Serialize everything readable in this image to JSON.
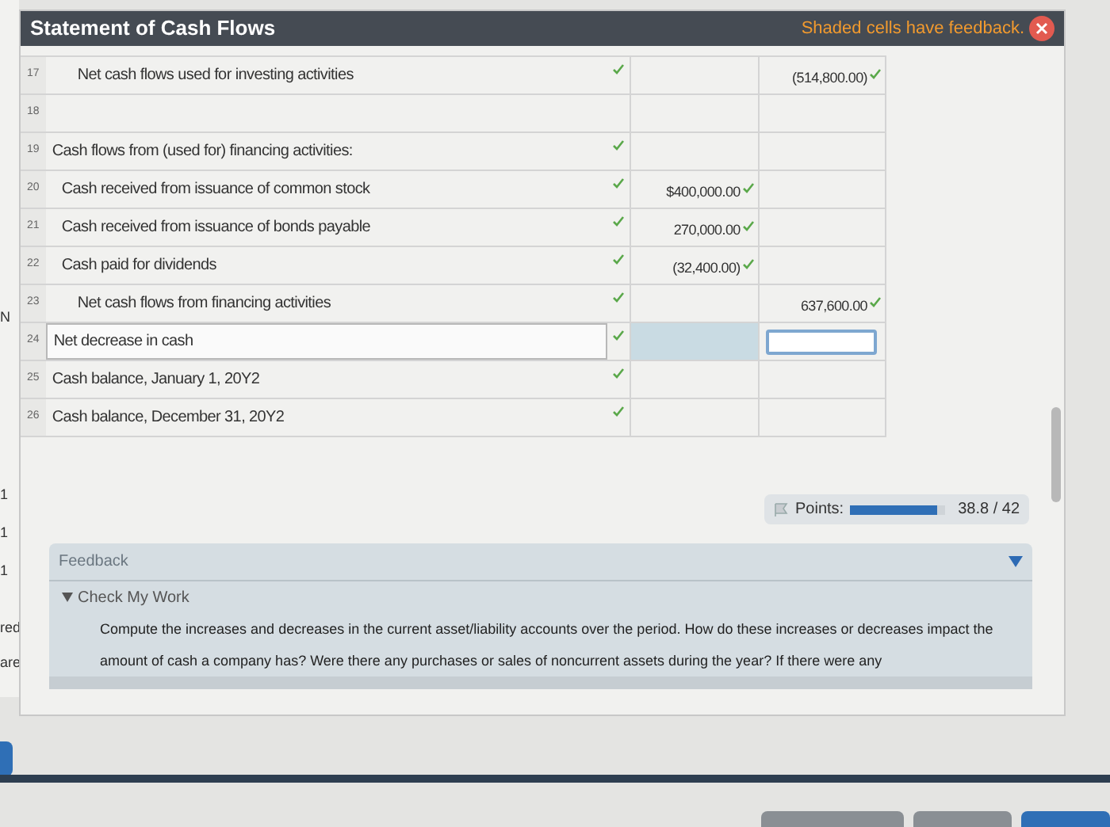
{
  "header": {
    "title": "Statement of Cash Flows",
    "feedback_note": "Shaded cells have feedback."
  },
  "side_fragments": [
    "N",
    "1",
    "1",
    "1",
    "red",
    "are"
  ],
  "rows": [
    {
      "number": "17",
      "label": "Net cash flows used for investing activities",
      "kind": "total",
      "checked": true,
      "amount_1": "",
      "amount_2": "(514,800.00)",
      "selected": false
    },
    {
      "number": "18",
      "label": "",
      "kind": "line",
      "checked": false,
      "amount_1": "",
      "amount_2": "",
      "selected": false
    },
    {
      "number": "19",
      "label": "Cash flows from (used for) financing activities:",
      "kind": "line",
      "checked": true,
      "amount_1": "",
      "amount_2": "",
      "selected": false
    },
    {
      "number": "20",
      "label": "Cash received from issuance of common stock",
      "kind": "item",
      "checked": true,
      "amount_1": "$400,000.00",
      "amount_2": "",
      "selected": false
    },
    {
      "number": "21",
      "label": "Cash received from issuance of bonds payable",
      "kind": "item",
      "checked": true,
      "amount_1": "270,000.00",
      "amount_2": "",
      "selected": false
    },
    {
      "number": "22",
      "label": "Cash paid for dividends",
      "kind": "item",
      "checked": true,
      "amount_1": "(32,400.00)",
      "amount_2": "",
      "selected": false
    },
    {
      "number": "23",
      "label": "Net cash flows from financing activities",
      "kind": "total",
      "checked": true,
      "amount_1": "",
      "amount_2": "637,600.00",
      "selected": false
    },
    {
      "number": "24",
      "label": "Net decrease in cash",
      "kind": "line",
      "checked": true,
      "amount_1": "",
      "amount_2": "",
      "selected": true
    },
    {
      "number": "25",
      "label": "Cash balance, January 1, 20Y2",
      "kind": "line",
      "checked": true,
      "amount_1": "",
      "amount_2": "",
      "selected": false
    },
    {
      "number": "26",
      "label": "Cash balance, December 31, 20Y2",
      "kind": "line",
      "checked": true,
      "amount_1": "",
      "amount_2": "",
      "selected": false
    }
  ],
  "points": {
    "label": "Points:",
    "level": 0.92,
    "score": "38.8 / 42"
  },
  "feedback": {
    "title": "Feedback",
    "section": "Check My Work",
    "expanded": true,
    "text": "Compute the increases and decreases in the current asset/liability accounts over the period. How do these increases or decreases impact the amount of cash a company has? Were there any purchases or sales of noncurrent assets during the year? If there were any"
  }
}
